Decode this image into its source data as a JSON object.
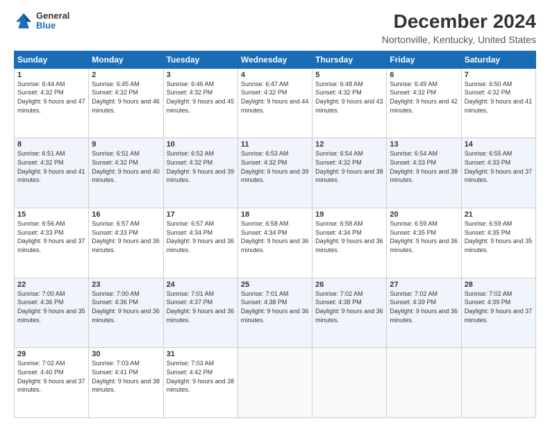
{
  "logo": {
    "general": "General",
    "blue": "Blue"
  },
  "title": "December 2024",
  "subtitle": "Nortonville, Kentucky, United States",
  "headers": [
    "Sunday",
    "Monday",
    "Tuesday",
    "Wednesday",
    "Thursday",
    "Friday",
    "Saturday"
  ],
  "weeks": [
    [
      {
        "day": "1",
        "sunrise": "6:44 AM",
        "sunset": "4:32 PM",
        "daylight": "9 hours and 47 minutes."
      },
      {
        "day": "2",
        "sunrise": "6:45 AM",
        "sunset": "4:32 PM",
        "daylight": "9 hours and 46 minutes."
      },
      {
        "day": "3",
        "sunrise": "6:46 AM",
        "sunset": "4:32 PM",
        "daylight": "9 hours and 45 minutes."
      },
      {
        "day": "4",
        "sunrise": "6:47 AM",
        "sunset": "4:32 PM",
        "daylight": "9 hours and 44 minutes."
      },
      {
        "day": "5",
        "sunrise": "6:48 AM",
        "sunset": "4:32 PM",
        "daylight": "9 hours and 43 minutes."
      },
      {
        "day": "6",
        "sunrise": "6:49 AM",
        "sunset": "4:32 PM",
        "daylight": "9 hours and 42 minutes."
      },
      {
        "day": "7",
        "sunrise": "6:50 AM",
        "sunset": "4:32 PM",
        "daylight": "9 hours and 41 minutes."
      }
    ],
    [
      {
        "day": "8",
        "sunrise": "6:51 AM",
        "sunset": "4:32 PM",
        "daylight": "9 hours and 41 minutes."
      },
      {
        "day": "9",
        "sunrise": "6:51 AM",
        "sunset": "4:32 PM",
        "daylight": "9 hours and 40 minutes."
      },
      {
        "day": "10",
        "sunrise": "6:52 AM",
        "sunset": "4:32 PM",
        "daylight": "9 hours and 39 minutes."
      },
      {
        "day": "11",
        "sunrise": "6:53 AM",
        "sunset": "4:32 PM",
        "daylight": "9 hours and 39 minutes."
      },
      {
        "day": "12",
        "sunrise": "6:54 AM",
        "sunset": "4:32 PM",
        "daylight": "9 hours and 38 minutes."
      },
      {
        "day": "13",
        "sunrise": "6:54 AM",
        "sunset": "4:33 PM",
        "daylight": "9 hours and 38 minutes."
      },
      {
        "day": "14",
        "sunrise": "6:55 AM",
        "sunset": "4:33 PM",
        "daylight": "9 hours and 37 minutes."
      }
    ],
    [
      {
        "day": "15",
        "sunrise": "6:56 AM",
        "sunset": "4:33 PM",
        "daylight": "9 hours and 37 minutes."
      },
      {
        "day": "16",
        "sunrise": "6:57 AM",
        "sunset": "4:33 PM",
        "daylight": "9 hours and 36 minutes."
      },
      {
        "day": "17",
        "sunrise": "6:57 AM",
        "sunset": "4:34 PM",
        "daylight": "9 hours and 36 minutes."
      },
      {
        "day": "18",
        "sunrise": "6:58 AM",
        "sunset": "4:34 PM",
        "daylight": "9 hours and 36 minutes."
      },
      {
        "day": "19",
        "sunrise": "6:58 AM",
        "sunset": "4:34 PM",
        "daylight": "9 hours and 36 minutes."
      },
      {
        "day": "20",
        "sunrise": "6:59 AM",
        "sunset": "4:35 PM",
        "daylight": "9 hours and 36 minutes."
      },
      {
        "day": "21",
        "sunrise": "6:59 AM",
        "sunset": "4:35 PM",
        "daylight": "9 hours and 35 minutes."
      }
    ],
    [
      {
        "day": "22",
        "sunrise": "7:00 AM",
        "sunset": "4:36 PM",
        "daylight": "9 hours and 35 minutes."
      },
      {
        "day": "23",
        "sunrise": "7:00 AM",
        "sunset": "4:36 PM",
        "daylight": "9 hours and 36 minutes."
      },
      {
        "day": "24",
        "sunrise": "7:01 AM",
        "sunset": "4:37 PM",
        "daylight": "9 hours and 36 minutes."
      },
      {
        "day": "25",
        "sunrise": "7:01 AM",
        "sunset": "4:38 PM",
        "daylight": "9 hours and 36 minutes."
      },
      {
        "day": "26",
        "sunrise": "7:02 AM",
        "sunset": "4:38 PM",
        "daylight": "9 hours and 36 minutes."
      },
      {
        "day": "27",
        "sunrise": "7:02 AM",
        "sunset": "4:39 PM",
        "daylight": "9 hours and 36 minutes."
      },
      {
        "day": "28",
        "sunrise": "7:02 AM",
        "sunset": "4:39 PM",
        "daylight": "9 hours and 37 minutes."
      }
    ],
    [
      {
        "day": "29",
        "sunrise": "7:02 AM",
        "sunset": "4:40 PM",
        "daylight": "9 hours and 37 minutes."
      },
      {
        "day": "30",
        "sunrise": "7:03 AM",
        "sunset": "4:41 PM",
        "daylight": "9 hours and 38 minutes."
      },
      {
        "day": "31",
        "sunrise": "7:03 AM",
        "sunset": "4:42 PM",
        "daylight": "9 hours and 38 minutes."
      },
      null,
      null,
      null,
      null
    ]
  ]
}
